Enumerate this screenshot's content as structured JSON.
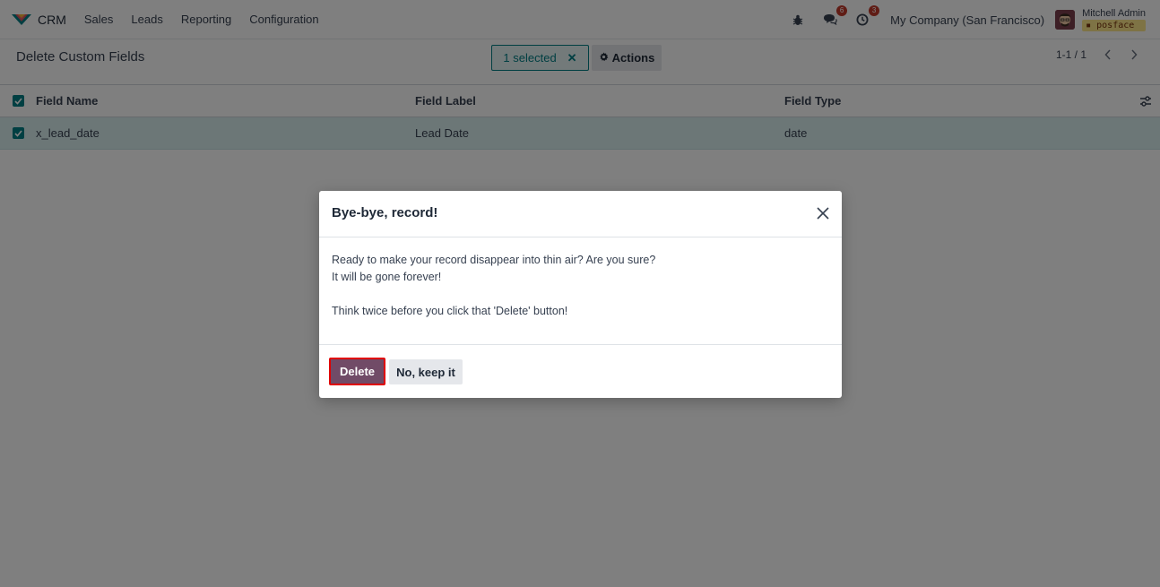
{
  "navbar": {
    "app_name": "CRM",
    "menu": [
      "Sales",
      "Leads",
      "Reporting",
      "Configuration"
    ],
    "icons": [
      "bug-icon",
      "chat-icon",
      "clock-icon"
    ],
    "chat_badge": "6",
    "activity_badge": "3",
    "company": "My Company (San Francisco)",
    "user_name": "Mitchell Admin",
    "database": "posface"
  },
  "control": {
    "page_title": "Delete Custom Fields",
    "selected_label": "1 selected",
    "clear_symbol": "✕",
    "actions_label": "Actions",
    "pager": "1-1 / 1"
  },
  "list": {
    "headers": [
      "Field Name",
      "Field Label",
      "Field Type"
    ],
    "rows": [
      {
        "field_name": "x_lead_date",
        "field_label": "Lead Date",
        "field_type": "date",
        "checked": true
      }
    ]
  },
  "modal": {
    "title": "Bye-bye, record!",
    "body_line1": "Ready to make your record disappear into thin air? Are you sure?",
    "body_line2": "It will be gone forever!",
    "body_line3": "Think twice before you click that 'Delete' button!",
    "delete_label": "Delete",
    "keep_label": "No, keep it"
  },
  "colors": {
    "brand": "#714b67",
    "accent_teal": "#017e84",
    "badge_red": "#c0392b",
    "selected_row": "#d9eeef",
    "focus_outline": "#e00000"
  }
}
